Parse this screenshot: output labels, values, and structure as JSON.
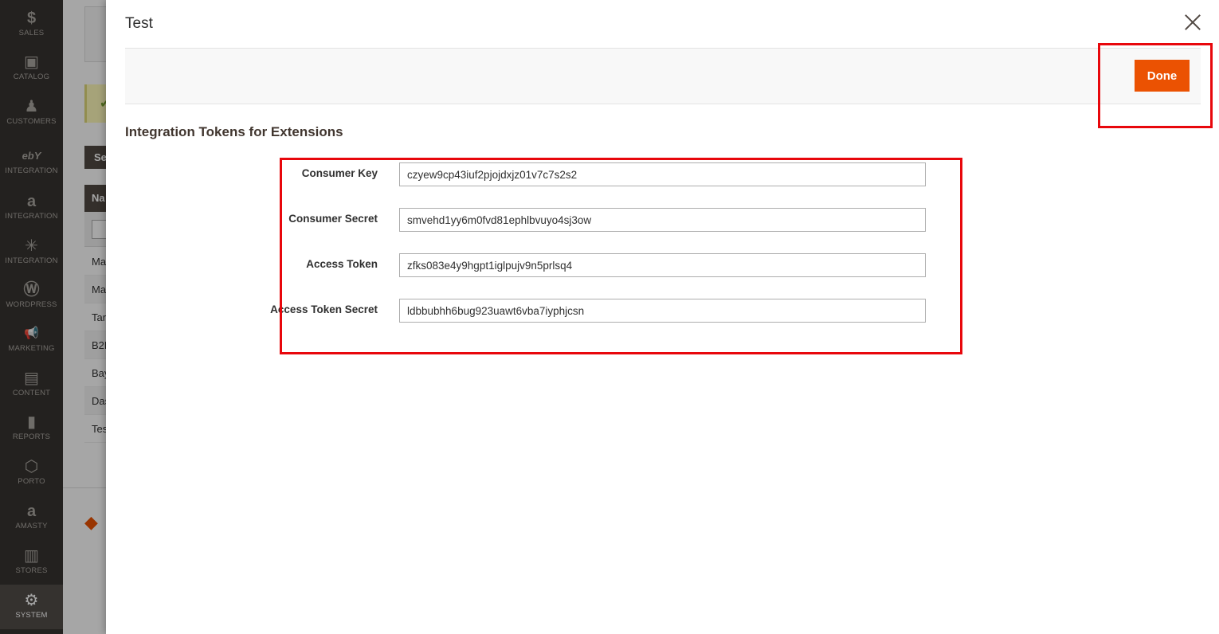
{
  "sidebar": {
    "items": [
      {
        "label": "SALES",
        "icon": "dollar-icon",
        "glyph": "$"
      },
      {
        "label": "CATALOG",
        "icon": "cube-icon",
        "glyph": "▣"
      },
      {
        "label": "CUSTOMERS",
        "icon": "person-icon",
        "glyph": "♟"
      },
      {
        "label": "INTEGRATION",
        "icon": "ebay-icon",
        "glyph": "ebY"
      },
      {
        "label": "INTEGRATION",
        "icon": "amazon-icon",
        "glyph": "a"
      },
      {
        "label": "INTEGRATION",
        "icon": "walmart-spark-icon",
        "glyph": "✳"
      },
      {
        "label": "WORDPRESS",
        "icon": "wordpress-icon",
        "glyph": "Ⓦ"
      },
      {
        "label": "MARKETING",
        "icon": "megaphone-icon",
        "glyph": "📢"
      },
      {
        "label": "CONTENT",
        "icon": "layout-icon",
        "glyph": "▤"
      },
      {
        "label": "REPORTS",
        "icon": "bar-chart-icon",
        "glyph": "▮"
      },
      {
        "label": "PORTO",
        "icon": "hexagon-icon",
        "glyph": "⬡"
      },
      {
        "label": "AMASTY",
        "icon": "amasty-icon",
        "glyph": "a"
      },
      {
        "label": "STORES",
        "icon": "store-icon",
        "glyph": "▥"
      },
      {
        "label": "SYSTEM",
        "icon": "gear-icon",
        "glyph": "⚙"
      }
    ]
  },
  "background": {
    "button_label": "Se",
    "table_header": "Na",
    "rows": [
      "Ma",
      "Ma",
      "Tar",
      "B2B",
      "Bay",
      "Das",
      "Tes"
    ]
  },
  "modal": {
    "title": "Test",
    "done_label": "Done",
    "section_title": "Integration Tokens for Extensions",
    "fields": [
      {
        "label": "Consumer Key",
        "value": "czyew9cp43iuf2pjojdxjz01v7c7s2s2"
      },
      {
        "label": "Consumer Secret",
        "value": "smvehd1yy6m0fvd81ephlbvuyo4sj3ow"
      },
      {
        "label": "Access Token",
        "value": "zfks083e4y9hgpt1iglpujv9n5prlsq4"
      },
      {
        "label": "Access Token Secret",
        "value": "ldbbubhh6bug923uawt6vba7iyphjcsn"
      }
    ]
  },
  "colors": {
    "sidebar_bg": "#373330",
    "accent": "#eb5202",
    "highlight": "#e8070c"
  }
}
